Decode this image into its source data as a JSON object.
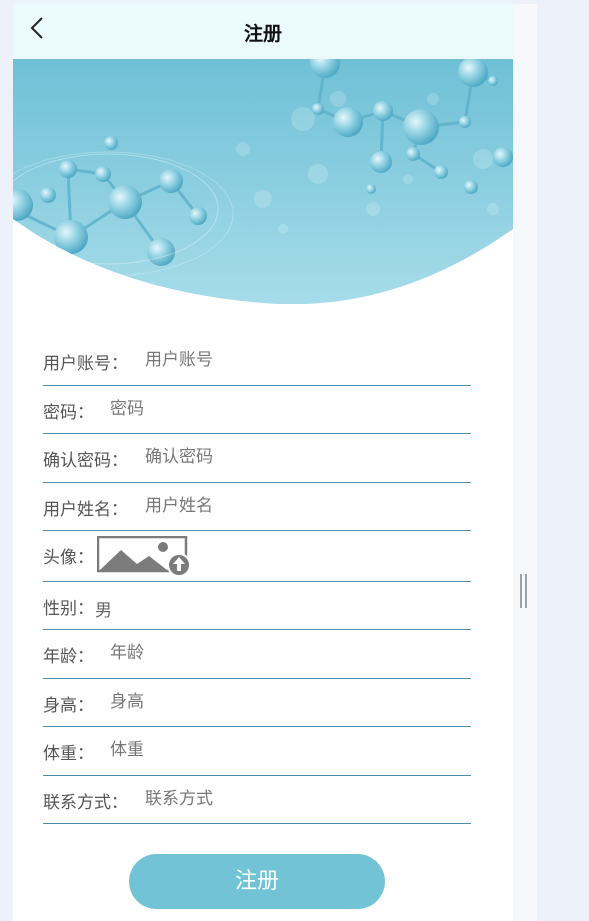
{
  "header": {
    "title": "注册"
  },
  "form": {
    "username": {
      "label": "用户账号：",
      "placeholder": "用户账号"
    },
    "password": {
      "label": "密码：",
      "placeholder": "密码"
    },
    "confirm_password": {
      "label": "确认密码：",
      "placeholder": "确认密码"
    },
    "real_name": {
      "label": "用户姓名：",
      "placeholder": "用户姓名"
    },
    "avatar": {
      "label": "头像："
    },
    "gender": {
      "label": "性别：",
      "value": "男"
    },
    "age": {
      "label": "年龄：",
      "placeholder": "年龄"
    },
    "height": {
      "label": "身高：",
      "placeholder": "身高"
    },
    "weight": {
      "label": "体重：",
      "placeholder": "体重"
    },
    "contact": {
      "label": "联系方式：",
      "placeholder": "联系方式"
    }
  },
  "submit_label": "注册",
  "colors": {
    "accent": "#72c3d6",
    "divider": "#4c8ea9",
    "header_bg": "#ebfafd",
    "banner": "#79c6db"
  }
}
